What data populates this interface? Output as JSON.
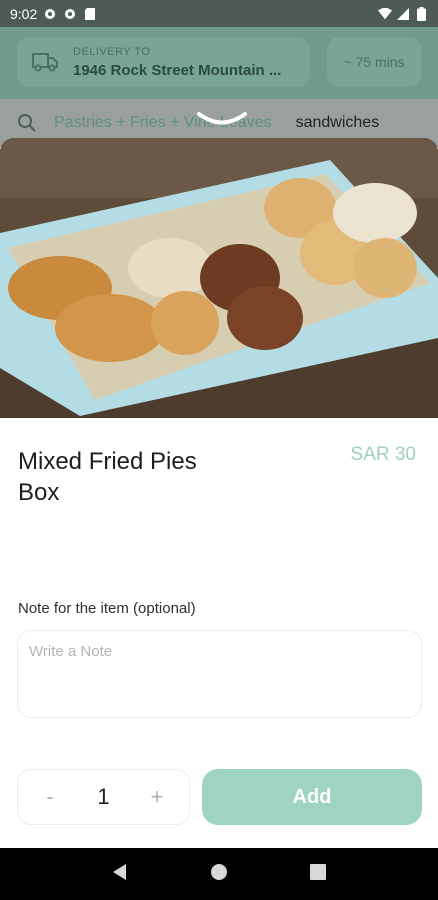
{
  "status_bar": {
    "time": "9:02",
    "left_icons": [
      "settings-icon",
      "settings-icon",
      "sd-card-icon"
    ],
    "right_icons": [
      "wifi-icon",
      "signal-icon",
      "battery-icon"
    ]
  },
  "header": {
    "delivery_label": "DELIVERY TO",
    "delivery_address": "1946 Rock Street Mountain ...",
    "delivery_time": "~ 75 mins"
  },
  "categories": {
    "tabs": [
      "Pastries + Fries + Vine Leaves",
      "sandwiches"
    ]
  },
  "product": {
    "name": "Mixed Fried Pies Box",
    "price": "SAR 30",
    "image_alt": "mixed fried pies box photo"
  },
  "note": {
    "label": "Note for the item (optional)",
    "placeholder": "Write a Note"
  },
  "quantity": {
    "minus": "-",
    "value": "1",
    "plus": "+"
  },
  "actions": {
    "add_label": "Add"
  },
  "colors": {
    "accent": "#9fd3c2",
    "price": "#9ed0c1",
    "header_bg": "#6f9a8e"
  }
}
